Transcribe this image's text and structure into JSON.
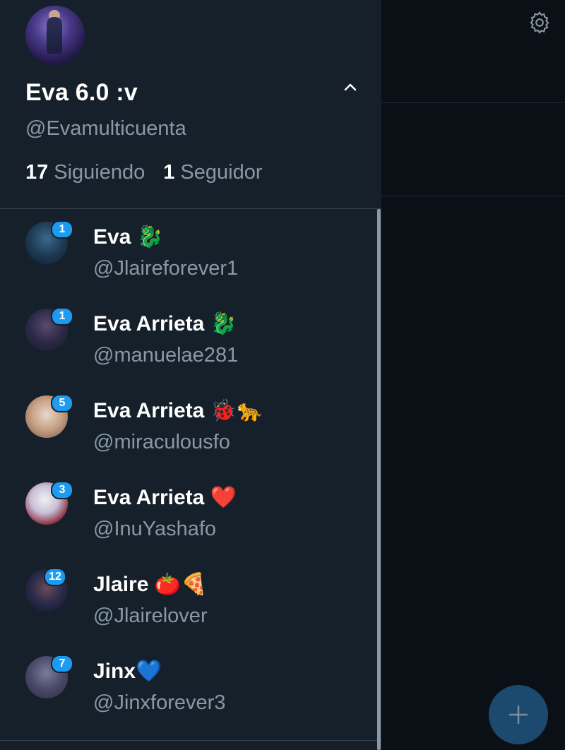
{
  "profile": {
    "display_name": "Eva 6.0 :v",
    "handle": "@Evamulticuenta",
    "following_count": "17",
    "following_label": "Siguiendo",
    "followers_count": "1",
    "followers_label": "Seguidor"
  },
  "accounts": [
    {
      "name": "Eva 🐉",
      "handle": "@Jlaireforever1",
      "badge": "1"
    },
    {
      "name": "Eva Arrieta 🐉",
      "handle": "@manuelae281",
      "badge": "1"
    },
    {
      "name": "Eva Arrieta 🐞🐆",
      "handle": "@miraculousfo",
      "badge": "5"
    },
    {
      "name": "Eva Arrieta ❤️",
      "handle": "@InuYashafo",
      "badge": "3"
    },
    {
      "name": "Jlaire 🍅🍕",
      "handle": "@Jlairelover",
      "badge": "12"
    },
    {
      "name": "Jinx💙",
      "handle": "@Jinxforever3",
      "badge": "7"
    }
  ],
  "icons": {
    "settings": "gear-icon",
    "collapse": "chevron-up-icon",
    "compose": "plus-icon"
  },
  "colors": {
    "drawer_bg": "#15202b",
    "badge": "#1d9bf0",
    "secondary_text": "#8899a6",
    "fab": "#1b4a6e"
  }
}
